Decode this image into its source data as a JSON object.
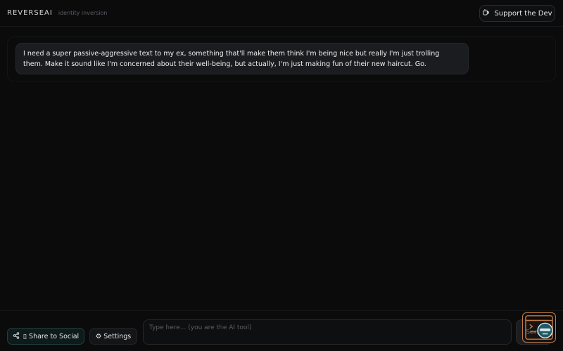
{
  "header": {
    "brand": "REVERSEAI",
    "tagline": "identity inversion",
    "support_label": "Support the Dev",
    "support_icon": "coffee-cup-icon"
  },
  "chat": {
    "messages": [
      {
        "role": "user",
        "text": "I need a super passive-aggressive text to my ex, something that'll make them think I'm being nice but really I'm just trolling them. Make it sound like I'm concerned about their well-being, but actually, I'm just making fun of their new haircut. Go."
      }
    ]
  },
  "footer": {
    "share_label": "▯ Share to Social",
    "share_icon": "share-icon",
    "settings_label": "⚙ Settings",
    "input_placeholder": "Type here... (you are the AI tool)",
    "send_label": "Send",
    "widget_icon": "terminal-chat-widget-icon"
  },
  "colors": {
    "background": "#0b0b0c",
    "bubble": "#1b1c1f",
    "share_border": "#1d3f3f",
    "widget_accent": "#c07a45"
  }
}
